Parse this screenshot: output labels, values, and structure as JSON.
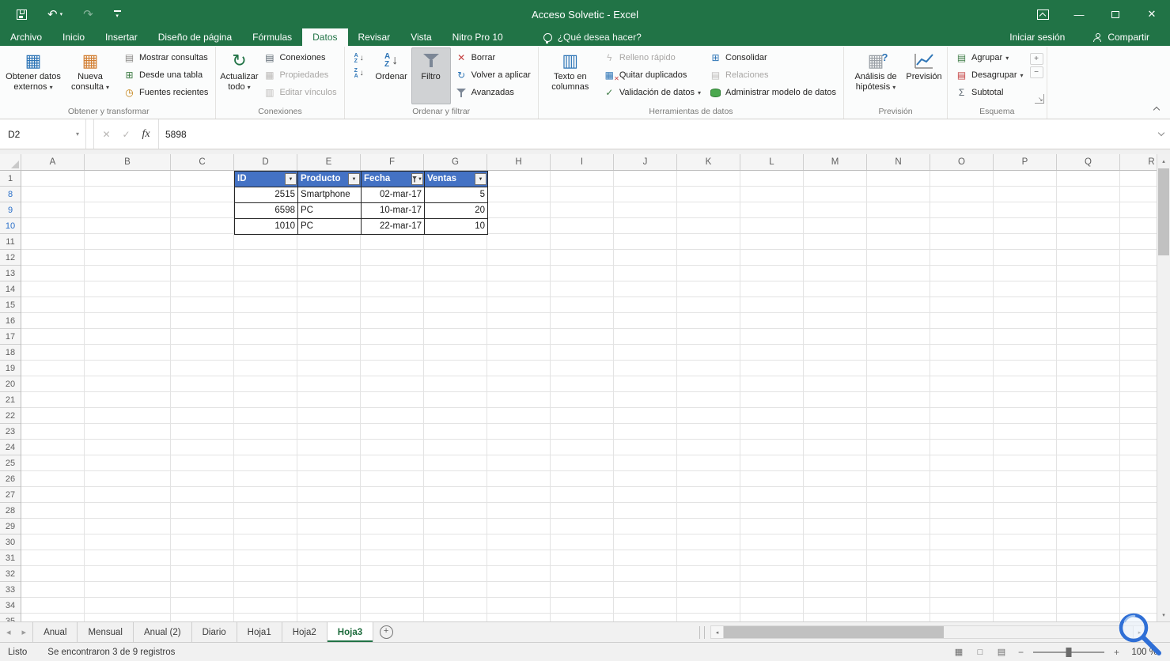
{
  "window": {
    "title": "Acceso Solvetic - Excel",
    "signin": "Iniciar sesión",
    "share": "Compartir",
    "tellme": "¿Qué desea hacer?"
  },
  "ribbon_tabs": [
    {
      "label": "Archivo",
      "active": false
    },
    {
      "label": "Inicio",
      "active": false
    },
    {
      "label": "Insertar",
      "active": false
    },
    {
      "label": "Diseño de página",
      "active": false
    },
    {
      "label": "Fórmulas",
      "active": false
    },
    {
      "label": "Datos",
      "active": true
    },
    {
      "label": "Revisar",
      "active": false
    },
    {
      "label": "Vista",
      "active": false
    },
    {
      "label": "Nitro Pro 10",
      "active": false
    }
  ],
  "ribbon": {
    "group_labels": [
      "Obtener y transformar",
      "Conexiones",
      "Ordenar y filtrar",
      "Herramientas de datos",
      "Previsión",
      "Esquema"
    ],
    "buttons": {
      "obtener_datos_externos": "Obtener datos externos",
      "nueva_consulta": "Nueva consulta",
      "mostrar_consultas": "Mostrar consultas",
      "desde_una_tabla": "Desde una tabla",
      "fuentes_recientes": "Fuentes recientes",
      "actualizar_todo": "Actualizar todo",
      "conexiones": "Conexiones",
      "propiedades": "Propiedades",
      "editar_vinculos": "Editar vínculos",
      "ordenar": "Ordenar",
      "filtro": "Filtro",
      "borrar": "Borrar",
      "volver_a_aplicar": "Volver a aplicar",
      "avanzadas": "Avanzadas",
      "texto_en_columnas": "Texto en columnas",
      "relleno_rapido": "Relleno rápido",
      "quitar_duplicados": "Quitar duplicados",
      "validacion_de_datos": "Validación de datos",
      "consolidar": "Consolidar",
      "relaciones": "Relaciones",
      "administrar_modelo_de_datos": "Administrar modelo de datos",
      "analisis_de_hipotesis": "Análisis de hipótesis",
      "prevision": "Previsión",
      "agrupar": "Agrupar",
      "desagrupar": "Desagrupar",
      "subtotal": "Subtotal"
    }
  },
  "formula_bar": {
    "name_box": "D2",
    "value": "5898"
  },
  "grid": {
    "columns": [
      "A",
      "B",
      "C",
      "D",
      "E",
      "F",
      "G",
      "H",
      "I",
      "J",
      "K",
      "L",
      "M",
      "N",
      "O",
      "P",
      "Q",
      "R"
    ],
    "rows": [
      "1",
      "8",
      "9",
      "10",
      "11",
      "12",
      "13",
      "14",
      "15",
      "16",
      "17",
      "18",
      "19",
      "20",
      "21",
      "22",
      "23",
      "24",
      "25",
      "26",
      "27",
      "28",
      "29",
      "30",
      "31",
      "32",
      "33",
      "34",
      "35"
    ],
    "filtered_rows": [
      "8",
      "9",
      "10"
    ]
  },
  "table": {
    "headers": [
      {
        "label": "ID",
        "filtered": false
      },
      {
        "label": "Producto",
        "filtered": false
      },
      {
        "label": "Fecha",
        "filtered": true
      },
      {
        "label": "Ventas",
        "filtered": false
      }
    ],
    "rows": [
      [
        "2515",
        "Smartphone",
        "02-mar-17",
        "5"
      ],
      [
        "6598",
        "PC",
        "10-mar-17",
        "20"
      ],
      [
        "1010",
        "PC",
        "22-mar-17",
        "10"
      ]
    ],
    "align": [
      "right",
      "left",
      "right",
      "right"
    ],
    "header_color": "#4472C4"
  },
  "sheet_tabs": [
    {
      "label": "Anual",
      "active": false
    },
    {
      "label": "Mensual",
      "active": false
    },
    {
      "label": "Anual (2)",
      "active": false
    },
    {
      "label": "Diario",
      "active": false
    },
    {
      "label": "Hoja1",
      "active": false
    },
    {
      "label": "Hoja2",
      "active": false
    },
    {
      "label": "Hoja3",
      "active": true
    }
  ],
  "status_bar": {
    "mode": "Listo",
    "filter_result": "Se encontraron 3 de 9 registros",
    "zoom": "100 %"
  },
  "colors": {
    "accent": "#217346",
    "table_header": "#4472C4",
    "filtered_row_number": "#2A6FC9"
  },
  "icons": {
    "dropdown": "▾",
    "filter_arrow": "▼",
    "table": "▦",
    "table_rows": "▤",
    "table_cols": "▥",
    "grid_plus": "⊞",
    "clock": "◷",
    "refresh": "↻",
    "check": "✓",
    "cross": "✕",
    "sigma": "Σ",
    "question": "?",
    "lightning": "ϟ",
    "letter_a": "A",
    "letter_z": "Z",
    "arrow_down": "↓",
    "undo": "↶",
    "redo": "↷",
    "minimize": "—",
    "close": "✕",
    "left": "◂",
    "right": "▸",
    "up": "▴",
    "down": "▾",
    "plus": "+",
    "minus": "−",
    "launcher": "↘",
    "box": "□",
    "fx": "fx"
  }
}
